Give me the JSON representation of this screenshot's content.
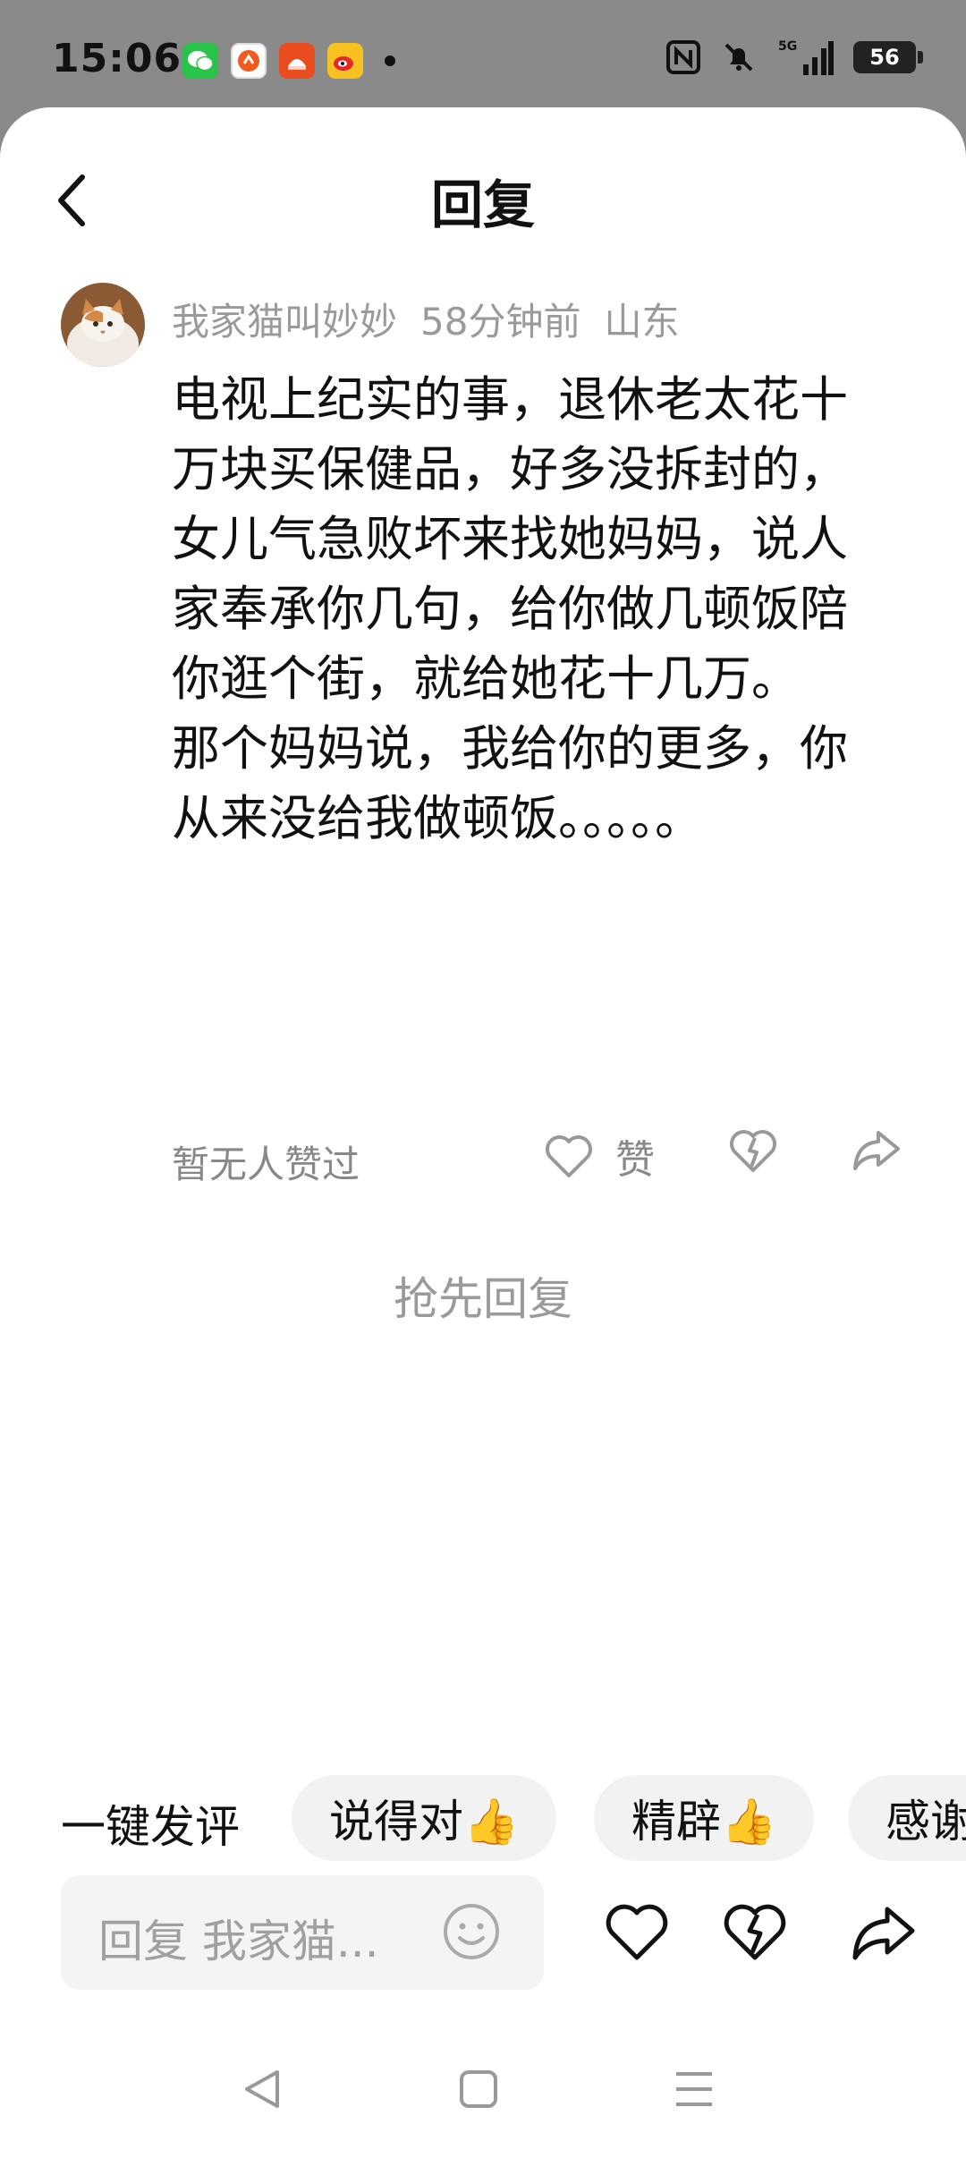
{
  "status_bar": {
    "time": "15:06",
    "network": "5G",
    "battery": "56",
    "app_icons": [
      "wechat-icon",
      "app-icon-orange",
      "app-icon-red",
      "weibo-icon"
    ]
  },
  "header": {
    "title": "回复",
    "back_icon": "chevron-left-icon"
  },
  "comment": {
    "author": "我家猫叫妙妙",
    "time_ago": "58分钟前",
    "location": "山东",
    "text": "电视上纪实的事，退休老太花十万块买保健品，好多没拆封的，女儿气急败坏来找她妈妈，说人家奉承你几句，给你做几顿饭陪你逛个街，就给她花十几万。\n那个妈妈说，我给你的更多，你从来没给我做顿饭。。。。。",
    "likes_status": "暂无人赞过",
    "like_label": "赞"
  },
  "first_reply_prompt": "抢先回复",
  "quick_reply": {
    "label": "一键发评",
    "chips": [
      "说得对👍",
      "精辟👍",
      "感谢"
    ]
  },
  "input_bar": {
    "placeholder": "回复 我家猫..."
  },
  "colors": {
    "status_bg": "#8a8a8a",
    "sheet_bg": "#ffffff",
    "muted_text": "#9a9a9a",
    "chip_bg": "#f2f2f2"
  }
}
